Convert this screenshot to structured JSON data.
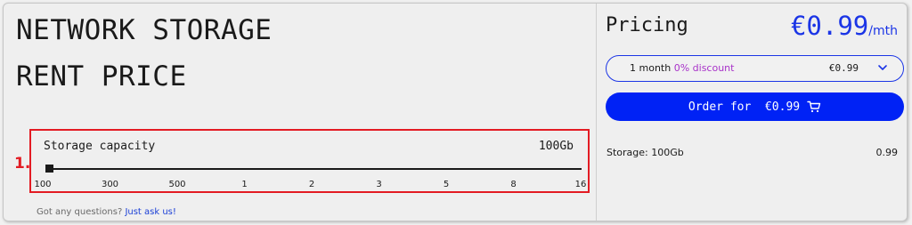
{
  "page": {
    "title_line1": "NETWORK STORAGE",
    "title_line2": "RENT PRICE"
  },
  "step": {
    "number": "1."
  },
  "storage": {
    "label": "Storage capacity",
    "value": "100Gb",
    "slider_position": 0,
    "ticks": [
      "100",
      "300",
      "500",
      "1",
      "2",
      "3",
      "5",
      "8",
      "16"
    ]
  },
  "help": {
    "question": "Got any questions?",
    "link": "Just ask us!"
  },
  "pricing": {
    "label": "Pricing",
    "price": "€0.99",
    "period": "/mth",
    "select": {
      "label": "1 month",
      "discount": "0% discount",
      "value": "€0.99"
    },
    "order_button": "Order for  €0.99",
    "summary_label": "Storage: 100Gb",
    "summary_value": "0.99"
  },
  "colors": {
    "accent": "#1b35e6",
    "button": "#0022f5",
    "discount": "#a832c9",
    "highlight": "#e31b23"
  },
  "icons": {
    "chevron": "chevron-down-icon",
    "cart": "cart-icon"
  }
}
